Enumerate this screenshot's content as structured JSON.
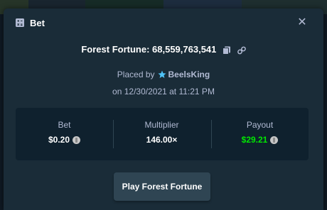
{
  "modal": {
    "title": "Bet",
    "close_label": "✕"
  },
  "game": {
    "label": "Forest Fortune: 68,559,763,541"
  },
  "placed": {
    "prefix": "Placed by",
    "username": "BeelsKing",
    "date_text": "on 12/30/2021 at 11:21 PM"
  },
  "stats": {
    "bet_label": "Bet",
    "bet_value": "$0.20",
    "multiplier_label": "Multiplier",
    "multiplier_value": "146.00×",
    "payout_label": "Payout",
    "payout_value": "$29.21"
  },
  "actions": {
    "play_label": "Play Forest Fortune"
  },
  "colors": {
    "payout_green": "#00e701",
    "modal_bg": "#1a2c38",
    "panel_bg": "#0f212e",
    "muted_text": "#b1bad3",
    "star": "#4fc3f7"
  },
  "icons": [
    "bet-ticket-icon",
    "close-icon",
    "copy-icon",
    "link-icon",
    "vip-star-icon",
    "currency-coin-icon"
  ]
}
